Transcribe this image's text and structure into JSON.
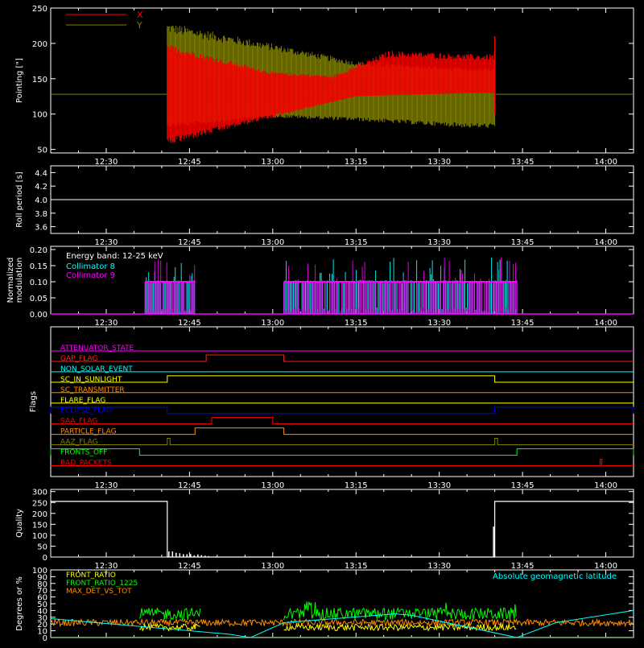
{
  "chart_data": [
    {
      "type": "line",
      "ylabel": "Pointing [\"]",
      "ylim": [
        45,
        250
      ],
      "yticks": [
        "50",
        "100",
        "150",
        "200",
        "250"
      ],
      "xticks": [
        "12:30",
        "12:45",
        "13:00",
        "13:15",
        "13:30",
        "13:45",
        "14:00"
      ],
      "xlim_minutes": [
        "12:20",
        "14:05"
      ],
      "legend_placement": "top-left",
      "series": [
        {
          "name": "X",
          "color": "#ff0000",
          "data_window": [
            "12:41",
            "13:40"
          ],
          "baseline": 128,
          "envelope_upper": [
            [
              12.68,
              200
            ],
            [
              13.0,
              160
            ],
            [
              13.18,
              155
            ],
            [
              13.35,
              190
            ],
            [
              13.6,
              185
            ]
          ],
          "envelope_lower": [
            [
              12.68,
              55
            ],
            [
              13.0,
              95
            ],
            [
              13.25,
              125
            ],
            [
              13.6,
              130
            ]
          ]
        },
        {
          "name": "Y",
          "color": "#808000",
          "data_window": [
            "12:41",
            "13:40"
          ],
          "baseline": 128,
          "envelope_upper": [
            [
              12.68,
              230
            ],
            [
              13.0,
              200
            ],
            [
              13.25,
              175
            ],
            [
              13.6,
              165
            ]
          ],
          "envelope_lower": [
            [
              12.68,
              80
            ],
            [
              13.0,
              95
            ],
            [
              13.25,
              90
            ],
            [
              13.6,
              80
            ]
          ]
        }
      ]
    },
    {
      "type": "line",
      "ylabel": "Roll period [s]",
      "ylim": [
        3.5,
        4.5
      ],
      "yticks": [
        "3.6",
        "3.8",
        "4.0",
        "4.2",
        "4.4"
      ],
      "xticks": [
        "12:30",
        "12:45",
        "13:00",
        "13:15",
        "13:30",
        "13:45",
        "14:00"
      ],
      "series": [
        {
          "name": "",
          "color": "#ffffff",
          "value": 4.0
        }
      ]
    },
    {
      "type": "line",
      "ylabel": "Normalized modulation",
      "ylim": [
        0,
        0.21
      ],
      "yticks": [
        "0.00",
        "0.05",
        "0.10",
        "0.15",
        "0.20"
      ],
      "xticks": [
        "12:30",
        "12:45",
        "13:00",
        "13:15",
        "13:30",
        "13:45",
        "14:00"
      ],
      "annotation": "Energy band: 12-25 keV",
      "legend_placement": "top-left",
      "series": [
        {
          "name": "Collimator 8",
          "color": "#00ffff",
          "typical": 0.1,
          "intervals": [
            [
              "12:37",
              "12:46"
            ],
            [
              "13:02",
              "13:44"
            ]
          ]
        },
        {
          "name": "Collimator 9",
          "color": "#ff00ff",
          "typical": 0.1,
          "intervals": [
            [
              "12:37",
              "12:46"
            ],
            [
              "13:02",
              "13:44"
            ]
          ]
        }
      ]
    },
    {
      "type": "line",
      "ylabel": "Flags",
      "xticks": [
        "12:30",
        "12:45",
        "13:00",
        "13:15",
        "13:30",
        "13:45",
        "14:00"
      ],
      "series": [
        {
          "name": "ATTENUATOR_STATE",
          "color": "#ff00ff",
          "high": []
        },
        {
          "name": "GAP_FLAG",
          "color": "#ff2020",
          "high": [
            [
              "12:48",
              "13:02"
            ]
          ]
        },
        {
          "name": "NON_SOLAR_EVENT",
          "color": "#00ffff",
          "high": []
        },
        {
          "name": "SC_IN_SUNLIGHT",
          "color": "#ffff00",
          "high": [
            [
              "12:41",
              "13:40"
            ]
          ]
        },
        {
          "name": "SC_TRANSMITTER",
          "color": "#ff8c00",
          "high": []
        },
        {
          "name": "FLARE_FLAG",
          "color": "#ffff00",
          "high": []
        },
        {
          "name": "ECLIPSE_FLAG",
          "color": "#0000ff",
          "high": [
            [
              "12:20",
              "12:41"
            ],
            [
              "13:40",
              "14:05"
            ]
          ]
        },
        {
          "name": "SAA_FLAG",
          "color": "#ff0000",
          "high": [
            [
              "12:49",
              "13:00"
            ]
          ]
        },
        {
          "name": "PARTICLE_FLAG",
          "color": "#ff8c00",
          "high": [
            [
              "12:46",
              "13:02"
            ]
          ]
        },
        {
          "name": "AAZ_FLAG",
          "color": "#808000",
          "high": [
            [
              "12:41",
              "12:41.5"
            ],
            [
              "13:40",
              "13:40.5"
            ]
          ]
        },
        {
          "name": "FRONTS_OFF",
          "color": "#00ff00",
          "high": [
            [
              "12:20",
              "12:36"
            ],
            [
              "13:44",
              "14:05"
            ]
          ]
        },
        {
          "name": "BAD_PACKETS",
          "color": "#ff0000",
          "high": [
            [
              "13:59",
              "13:59.3"
            ]
          ]
        }
      ]
    },
    {
      "type": "line",
      "ylabel": "Quality",
      "ylim": [
        0,
        310
      ],
      "yticks": [
        "0",
        "50",
        "100",
        "150",
        "200",
        "250",
        "300"
      ],
      "xticks": [
        "12:30",
        "12:45",
        "13:00",
        "13:15",
        "13:30",
        "13:45",
        "14:00"
      ],
      "series": [
        {
          "name": "",
          "color": "#ffffff",
          "points": [
            [
              "12:20",
              255
            ],
            [
              "12:41",
              255
            ],
            [
              "12:41",
              0
            ],
            [
              "13:40",
              0
            ],
            [
              "13:40",
              255
            ],
            [
              "14:05",
              255
            ]
          ]
        }
      ]
    },
    {
      "type": "line",
      "ylabel": "Degrees or %",
      "ylim": [
        0,
        100
      ],
      "yticks": [
        "0",
        "10",
        "20",
        "30",
        "40",
        "50",
        "60",
        "70",
        "80",
        "90",
        "100"
      ],
      "xticks": [
        "12:30",
        "12:45",
        "13:00",
        "13:15",
        "13:30",
        "13:45",
        "14:00"
      ],
      "legend_placement": "top-left",
      "annotation": "Absolute geomagnetic latitude",
      "annotation_color": "#00ffff",
      "series": [
        {
          "name": "FRONT_RATIO",
          "color": "#ffff00",
          "typical": 15,
          "intervals": [
            [
              "12:36",
              "12:47"
            ],
            [
              "13:02",
              "13:44"
            ]
          ]
        },
        {
          "name": "FRONT_RATIO_1225",
          "color": "#00ff00",
          "typical": 35,
          "intervals": [
            [
              "12:36",
              "12:47"
            ],
            [
              "13:02",
              "13:44"
            ]
          ]
        },
        {
          "name": "MAX_DET_VS_TOT",
          "color": "#ff8c00",
          "typical": 22,
          "intervals": [
            [
              "12:20",
              "14:05"
            ]
          ]
        },
        {
          "name": "Absolute geomagnetic latitude",
          "color": "#00ffff",
          "points": [
            [
              "12:20",
              28
            ],
            [
              "12:52",
              5
            ],
            [
              "12:56",
              0
            ],
            [
              "13:02",
              22
            ],
            [
              "13:22",
              35
            ],
            [
              "13:25",
              33
            ],
            [
              "13:44",
              0
            ],
            [
              "13:51",
              22
            ],
            [
              "14:05",
              40
            ]
          ]
        }
      ]
    }
  ]
}
